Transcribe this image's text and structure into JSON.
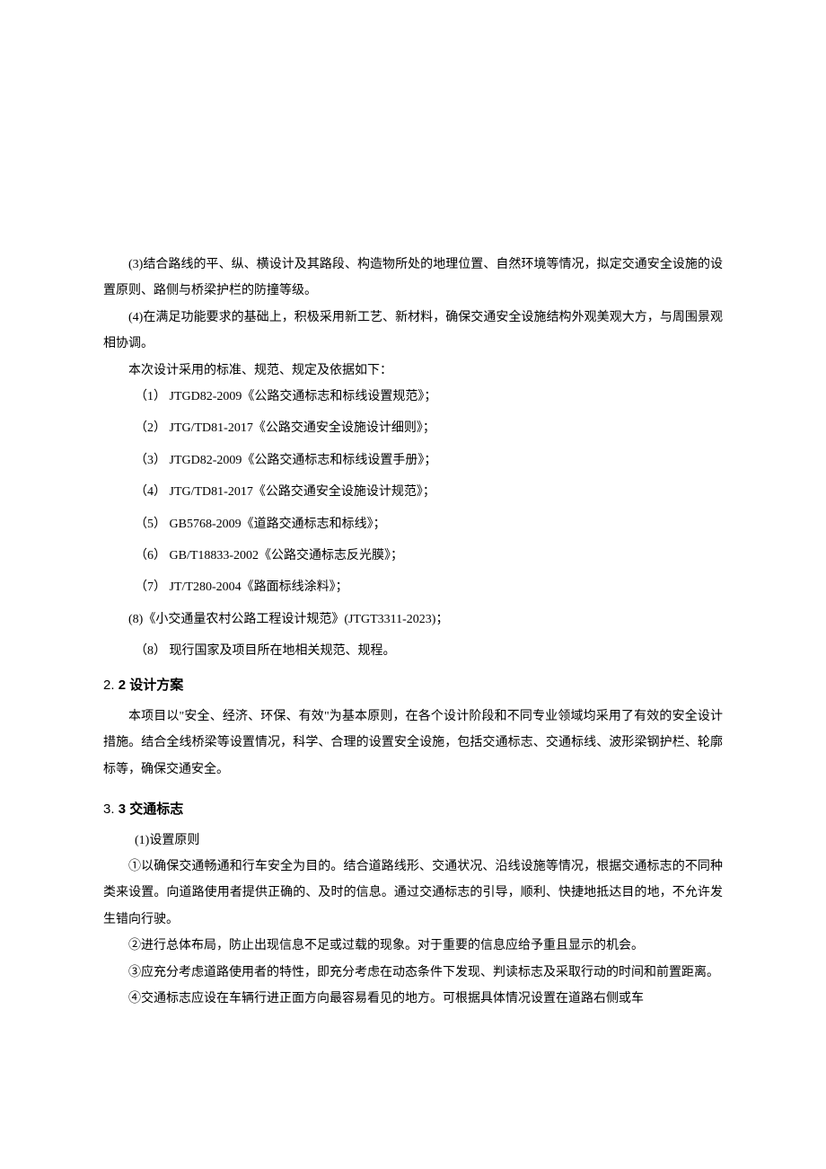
{
  "paragraphs": {
    "p3": "(3)结合路线的平、纵、横设计及其路段、构造物所处的地理位置、自然环境等情况，拟定交通安全设施的设置原则、路侧与桥梁护栏的防撞等级。",
    "p4": "(4)在满足功能要求的基础上，积极采用新工艺、新材料，确保交通安全设施结构外观美观大方，与周围景观相协调。",
    "intro": "本次设计采用的标准、规范、规定及依据如下："
  },
  "standards": [
    "（1）  JTGD82-2009《公路交通标志和标线设置规范》；",
    "（2）  JTG/TD81-2017《公路交通安全设施设计细则》；",
    "（3）  JTGD82-2009《公路交通标志和标线设置手册》；",
    "（4）  JTG/TD81-2017《公路交通安全设施设计规范》；",
    "（5）  GB5768-2009《道路交通标志和标线》；",
    "（6）  GB/T18833-2002《公路交通标志反光膜》；",
    "（7）  JT/T280-2004《路面标线涂料》；"
  ],
  "standards_extra": [
    "(8)《小交通量农村公路工程设计规范》(JTGT3311-2023)；",
    "（8）  现行国家及项目所在地相关规范、规程。"
  ],
  "section22": {
    "heading_num": "2.",
    "heading_label": "2 设计方案",
    "body": "本项目以\"安全、经济、环保、有效\"为基本原则，在各个设计阶段和不同专业领域均采用了有效的安全设计措施。结合全线桥梁等设置情况，科学、合理的设置安全设施，包括交通标志、交通标线、波形梁钢护栏、轮廓标等，确保交通安全。"
  },
  "section33": {
    "heading_num": "3.",
    "heading_label": "3 交通标志",
    "sub1": "(1)设置原则",
    "c1": "①以确保交通畅通和行车安全为目的。结合道路线形、交通状况、沿线设施等情况，根据交通标志的不同种类来设置。向道路使用者提供正确的、及时的信息。通过交通标志的引导，顺利、快捷地抵达目的地，不允许发生错向行驶。",
    "c2": "②进行总体布局，防止出现信息不足或过载的现象。对于重要的信息应给予重且显示的机会。",
    "c3": "③应充分考虑道路使用者的特性，即充分考虑在动态条件下发现、判读标志及采取行动的时间和前置距离。",
    "c4": "④交通标志应设在车辆行进正面方向最容易看见的地方。可根据具体情况设置在道路右侧或车"
  }
}
